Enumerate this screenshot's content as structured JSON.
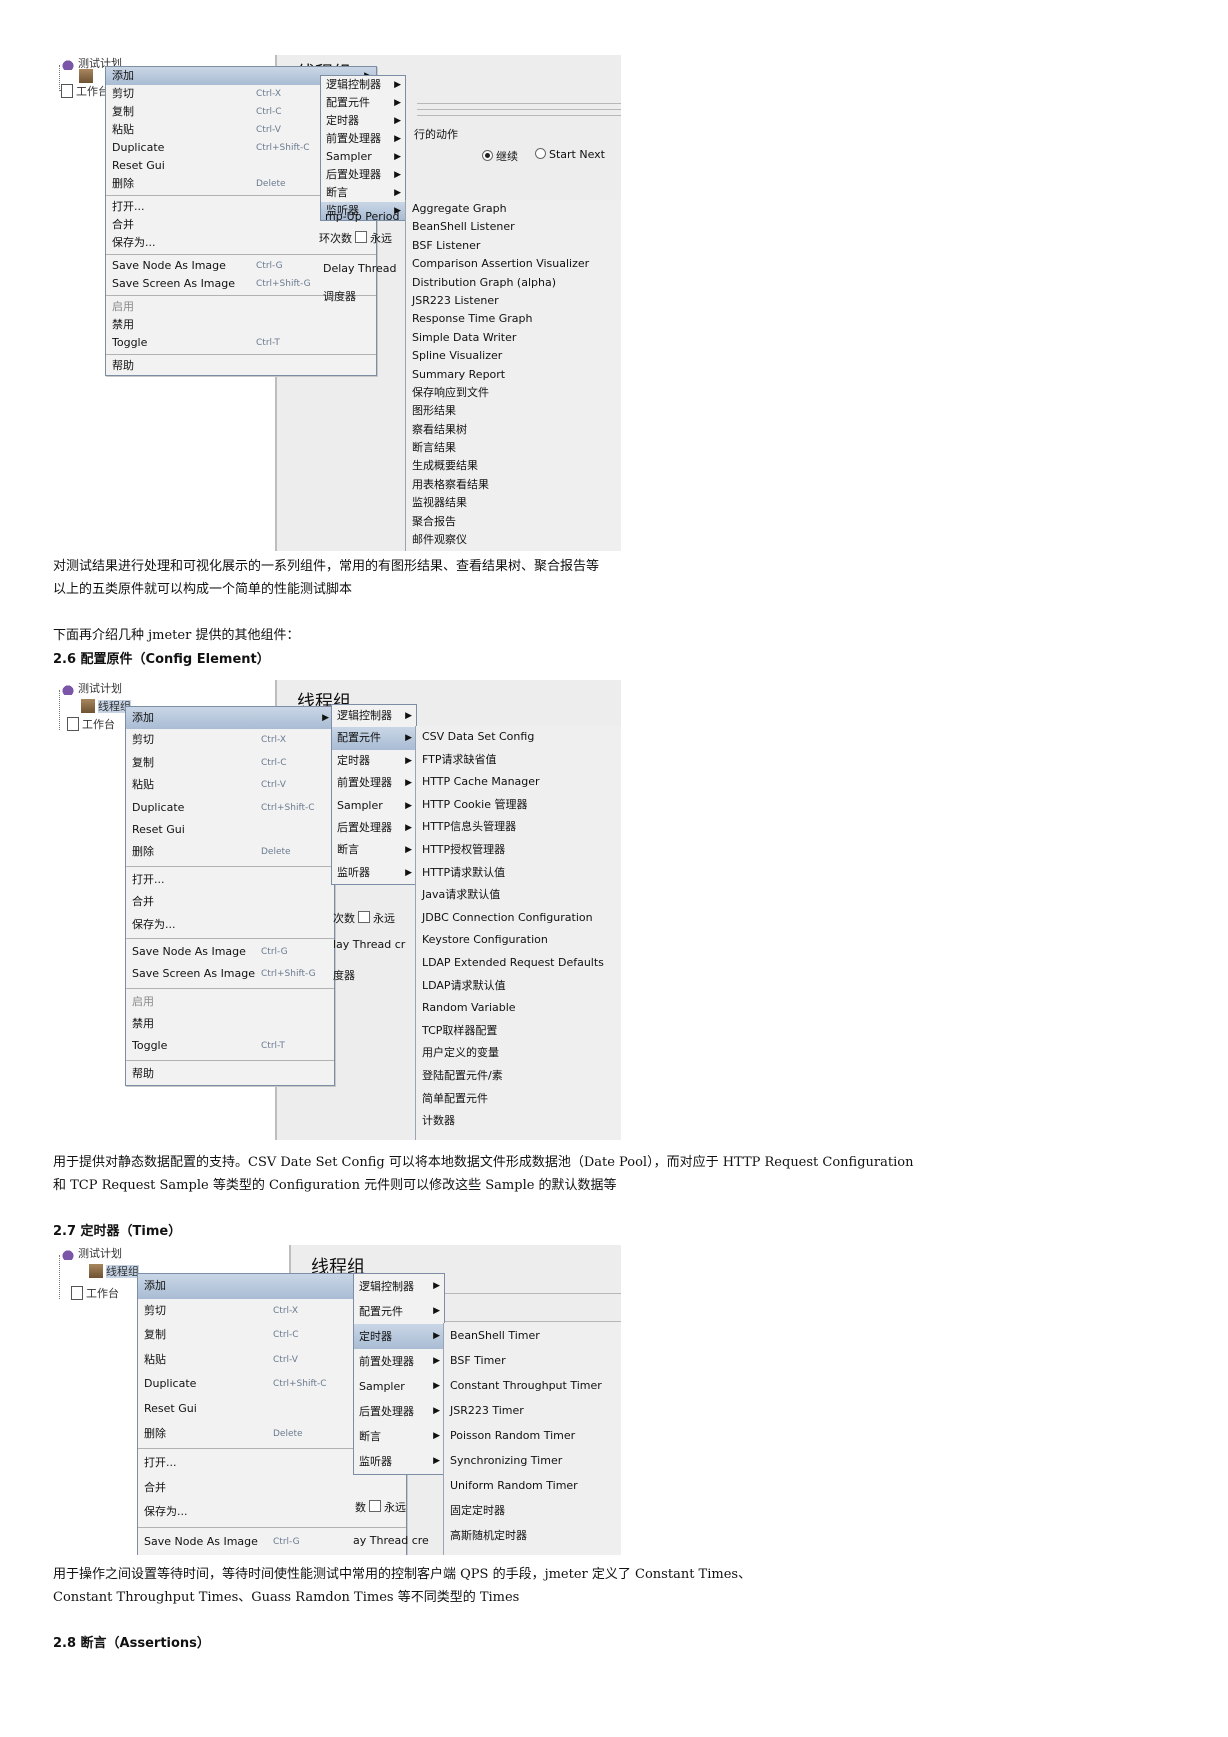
{
  "shot1": {
    "panel_title": "线程组",
    "tree": {
      "plan": "测试计划",
      "group": "线程组",
      "workbench": "工作台"
    },
    "menu": [
      {
        "label": "添加",
        "shortcut": "",
        "highlight": true,
        "arrow": true
      },
      {
        "label": "剪切",
        "shortcut": "Ctrl-X"
      },
      {
        "label": "复制",
        "shortcut": "Ctrl-C"
      },
      {
        "label": "粘贴",
        "shortcut": "Ctrl-V"
      },
      {
        "label": "Duplicate",
        "shortcut": "Ctrl+Shift-C"
      },
      {
        "label": "Reset Gui",
        "shortcut": ""
      },
      {
        "label": "删除",
        "shortcut": "Delete"
      },
      {
        "sep": true
      },
      {
        "label": "打开...",
        "shortcut": ""
      },
      {
        "label": "合并",
        "shortcut": ""
      },
      {
        "label": "保存为...",
        "shortcut": ""
      },
      {
        "sep": true
      },
      {
        "label": "Save Node As Image",
        "shortcut": "Ctrl-G"
      },
      {
        "label": "Save Screen As Image",
        "shortcut": "Ctrl+Shift-G"
      },
      {
        "sep": true
      },
      {
        "label": "启用",
        "shortcut": "",
        "disabled": true
      },
      {
        "label": "禁用",
        "shortcut": ""
      },
      {
        "label": "Toggle",
        "shortcut": "Ctrl-T"
      },
      {
        "sep": true
      },
      {
        "label": "帮助",
        "shortcut": ""
      }
    ],
    "submenu": [
      {
        "label": "逻辑控制器",
        "arrow": true
      },
      {
        "label": "配置元件",
        "arrow": true
      },
      {
        "label": "定时器",
        "arrow": true
      },
      {
        "label": "前置处理器",
        "arrow": true
      },
      {
        "label": "Sampler",
        "arrow": true
      },
      {
        "label": "后置处理器",
        "arrow": true
      },
      {
        "label": "断言",
        "arrow": true
      },
      {
        "label": "监听器",
        "arrow": true,
        "highlight": true
      }
    ],
    "list": [
      "Aggregate Graph",
      "BeanShell Listener",
      "BSF Listener",
      "Comparison Assertion Visualizer",
      "Distribution Graph (alpha)",
      "JSR223 Listener",
      "Response Time Graph",
      "Simple Data Writer",
      "Spline Visualizer",
      "Summary Report",
      "保存响应到文件",
      "图形结果",
      "察看结果树",
      "断言结果",
      "生成概要结果",
      "用表格察看结果",
      "监视器结果",
      "聚合报告",
      "邮件观察仪"
    ],
    "fragments": {
      "action": "行的动作",
      "continue": "继续",
      "start_next": "Start Next",
      "rampup": "mp-Up Period",
      "loops": "环次数",
      "forever": "永远",
      "delay": "Delay Thread",
      "scheduler": "调度器"
    }
  },
  "para1_line1": "对测试结果进行处理和可视化展示的一系列组件，常用的有图形结果、查看结果树、聚合报告等",
  "para1_line2": "以上的五类原件就可以构成一个简单的性能测试脚本",
  "para2": "下面再介绍几种 jmeter 提供的其他组件：",
  "heading_26": "2.6 配置原件（Config Element）",
  "shot2": {
    "panel_title": "线程组",
    "tree": {
      "plan": "测试计划",
      "group": "线程组",
      "workbench": "工作台"
    },
    "menu": [
      {
        "label": "添加",
        "shortcut": "",
        "highlight": true,
        "arrow": true
      },
      {
        "label": "剪切",
        "shortcut": "Ctrl-X"
      },
      {
        "label": "复制",
        "shortcut": "Ctrl-C"
      },
      {
        "label": "粘贴",
        "shortcut": "Ctrl-V"
      },
      {
        "label": "Duplicate",
        "shortcut": "Ctrl+Shift-C"
      },
      {
        "label": "Reset Gui",
        "shortcut": ""
      },
      {
        "label": "删除",
        "shortcut": "Delete"
      },
      {
        "sep": true
      },
      {
        "label": "打开...",
        "shortcut": ""
      },
      {
        "label": "合并",
        "shortcut": ""
      },
      {
        "label": "保存为...",
        "shortcut": ""
      },
      {
        "sep": true
      },
      {
        "label": "Save Node As Image",
        "shortcut": "Ctrl-G"
      },
      {
        "label": "Save Screen As Image",
        "shortcut": "Ctrl+Shift-G"
      },
      {
        "sep": true
      },
      {
        "label": "启用",
        "shortcut": "",
        "disabled": true
      },
      {
        "label": "禁用",
        "shortcut": ""
      },
      {
        "label": "Toggle",
        "shortcut": "Ctrl-T"
      },
      {
        "sep": true
      },
      {
        "label": "帮助",
        "shortcut": ""
      }
    ],
    "submenu": [
      {
        "label": "逻辑控制器",
        "arrow": true
      },
      {
        "label": "配置元件",
        "arrow": true,
        "highlight": true
      },
      {
        "label": "定时器",
        "arrow": true
      },
      {
        "label": "前置处理器",
        "arrow": true
      },
      {
        "label": "Sampler",
        "arrow": true
      },
      {
        "label": "后置处理器",
        "arrow": true
      },
      {
        "label": "断言",
        "arrow": true
      },
      {
        "label": "监听器",
        "arrow": true
      }
    ],
    "list": [
      "CSV Data Set Config",
      "FTP请求缺省值",
      "HTTP Cache Manager",
      "HTTP Cookie 管理器",
      "HTTP信息头管理器",
      "HTTP授权管理器",
      "HTTP请求默认值",
      "Java请求默认值",
      "JDBC Connection Configuration",
      "Keystore Configuration",
      "LDAP Extended Request Defaults",
      "LDAP请求默认值",
      "Random Variable",
      "TCP取样器配置",
      "用户定义的变量",
      "登陆配置元件/素",
      "简单配置元件",
      "计数器"
    ],
    "fragments": {
      "loops": "次数",
      "forever": "永远",
      "delay": "lay Thread cr",
      "scheduler": "度器"
    }
  },
  "para3_line1": "用于提供对静态数据配置的支持。CSV Date Set Config 可以将本地数据文件形成数据池（Date Pool），而对应于 HTTP Request Configuration",
  "para3_line2": "和 TCP Request Sample 等类型的 Configuration 元件则可以修改这些 Sample 的默认数据等",
  "heading_27": "2.7 定时器（Time）",
  "shot3": {
    "panel_title": "线程组",
    "tree": {
      "plan": "测试计划",
      "group": "线程组",
      "workbench": "工作台"
    },
    "menu": [
      {
        "label": "添加",
        "shortcut": "",
        "highlight": true,
        "arrow": true
      },
      {
        "label": "剪切",
        "shortcut": "Ctrl-X"
      },
      {
        "label": "复制",
        "shortcut": "Ctrl-C"
      },
      {
        "label": "粘贴",
        "shortcut": "Ctrl-V"
      },
      {
        "label": "Duplicate",
        "shortcut": "Ctrl+Shift-C"
      },
      {
        "label": "Reset Gui",
        "shortcut": ""
      },
      {
        "label": "删除",
        "shortcut": "Delete"
      },
      {
        "sep": true
      },
      {
        "label": "打开...",
        "shortcut": ""
      },
      {
        "label": "合并",
        "shortcut": ""
      },
      {
        "label": "保存为...",
        "shortcut": ""
      },
      {
        "sep": true
      },
      {
        "label": "Save Node As Image",
        "shortcut": "Ctrl-G"
      }
    ],
    "submenu": [
      {
        "label": "逻辑控制器",
        "arrow": true
      },
      {
        "label": "配置元件",
        "arrow": true
      },
      {
        "label": "定时器",
        "arrow": true,
        "highlight": true
      },
      {
        "label": "前置处理器",
        "arrow": true
      },
      {
        "label": "Sampler",
        "arrow": true
      },
      {
        "label": "后置处理器",
        "arrow": true
      },
      {
        "label": "断言",
        "arrow": true
      },
      {
        "label": "监听器",
        "arrow": true
      }
    ],
    "list": [
      "BeanShell Timer",
      "BSF Timer",
      "Constant Throughput Timer",
      "JSR223 Timer",
      "Poisson Random Timer",
      "Synchronizing Timer",
      "Uniform Random Timer",
      "固定定时器",
      "高斯随机定时器"
    ],
    "fragments": {
      "loops": "数",
      "forever": "永远",
      "delay": "ay Thread cre"
    }
  },
  "para4_line1": "用于操作之间设置等待时间，等待时间使性能测试中常用的控制客户端 QPS 的手段，jmeter 定义了 Constant Times、",
  "para4_line2": "Constant Throughput Times、Guass Ramdon Times 等不同类型的 Times",
  "heading_28": "2.8 断言（Assertions）"
}
